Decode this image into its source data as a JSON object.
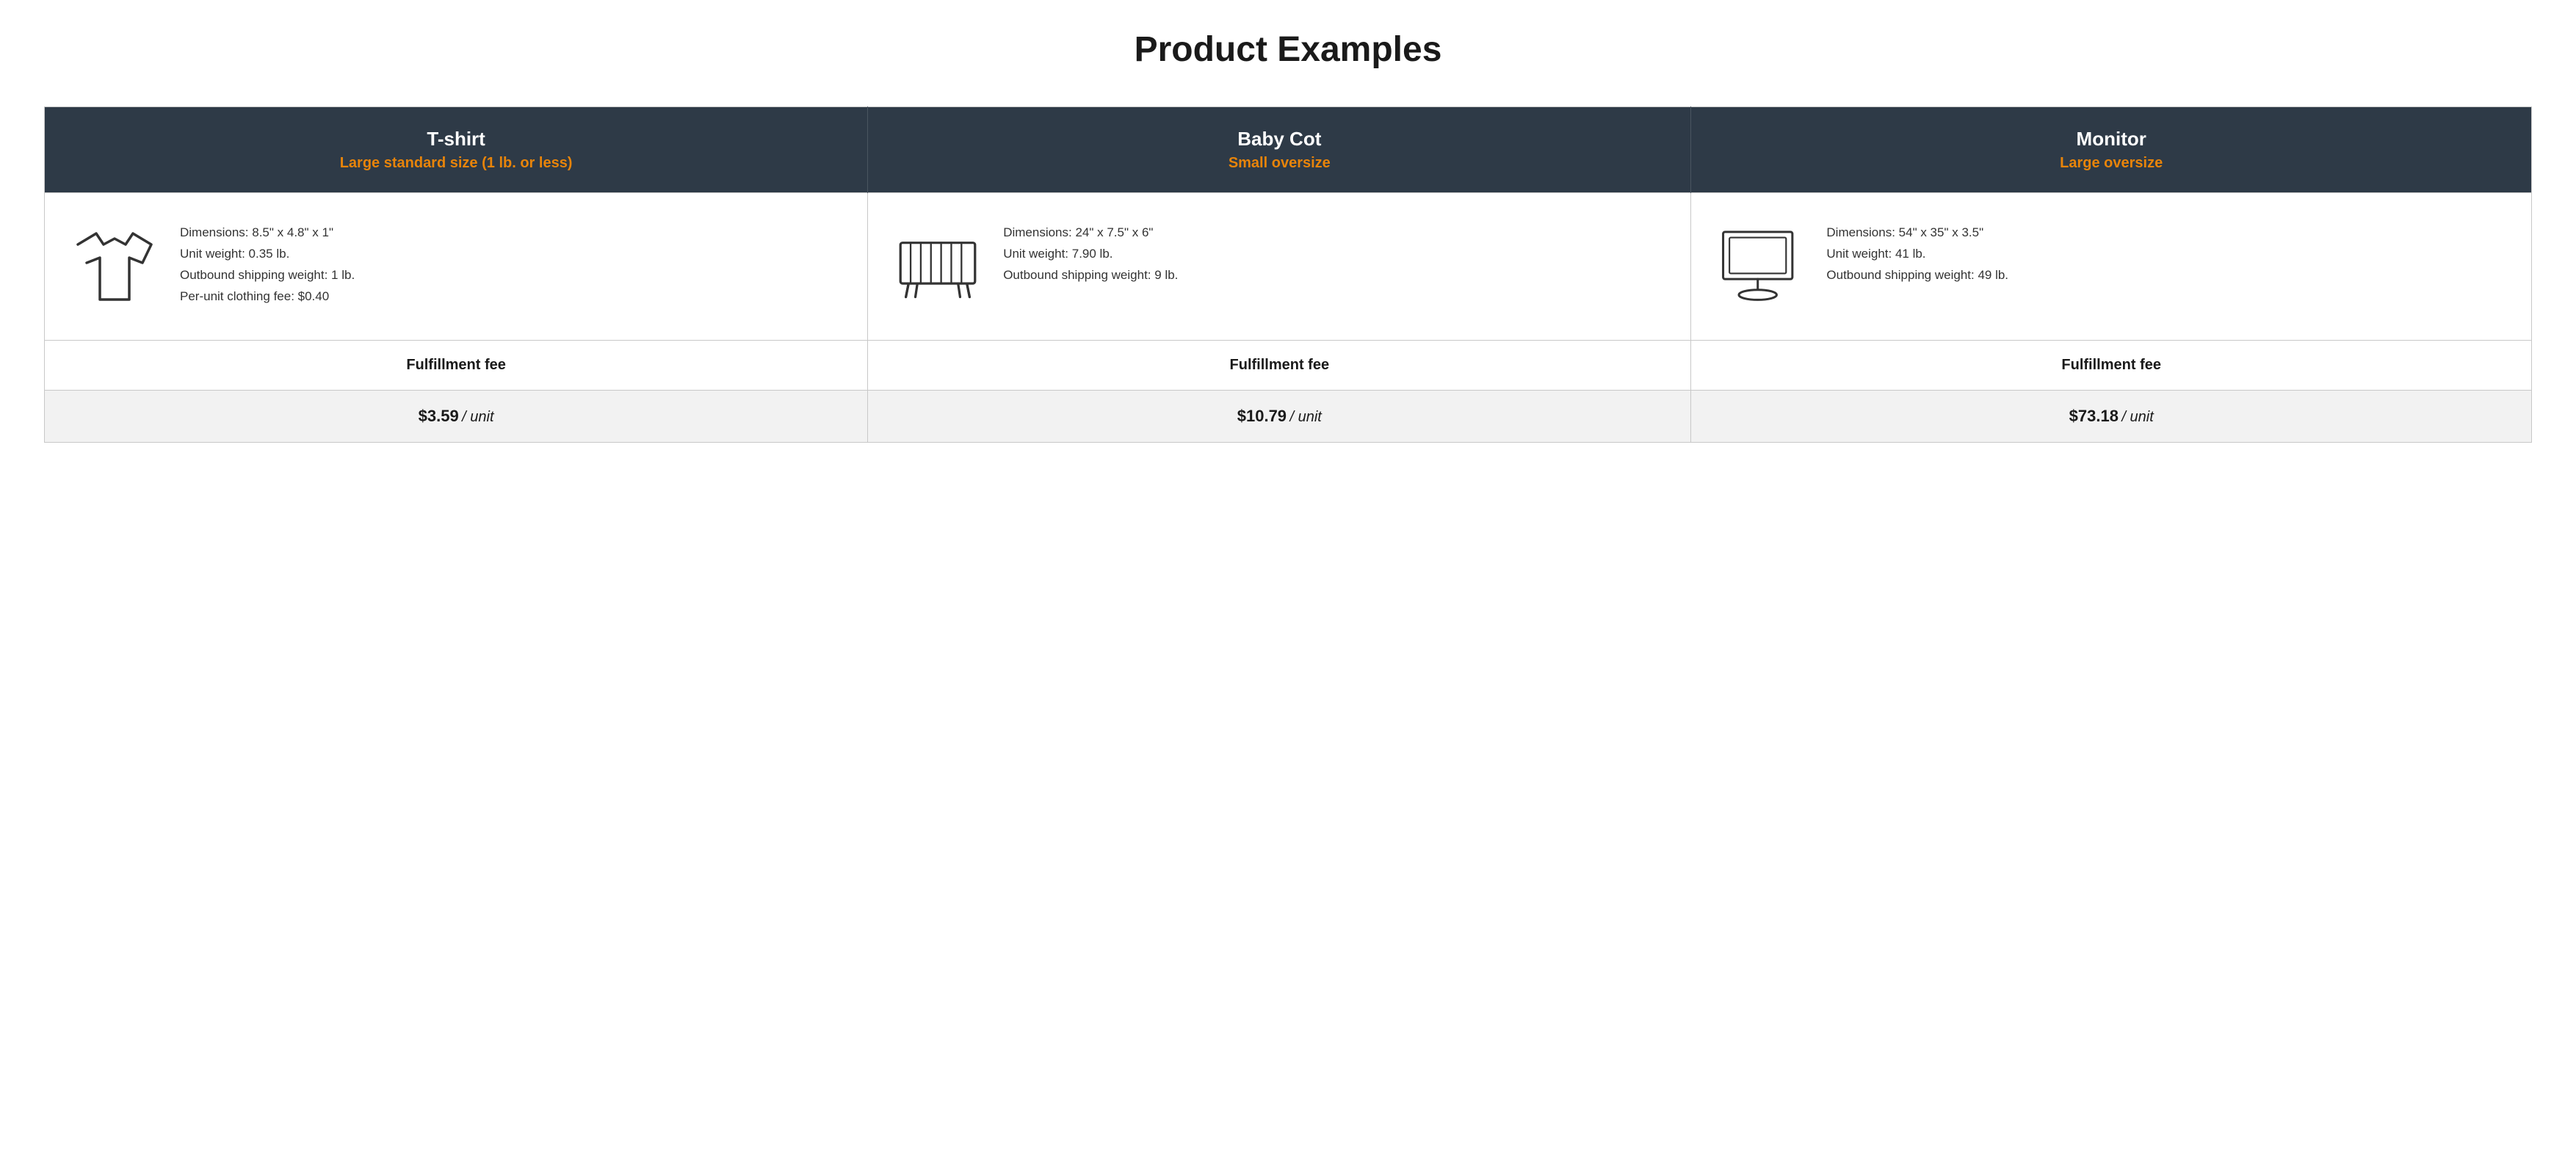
{
  "page": {
    "title": "Product Examples"
  },
  "products": [
    {
      "id": "tshirt",
      "name": "T-shirt",
      "size_label": "Large standard size (1 lb. or less)",
      "dimensions": "Dimensions: 8.5\" x 4.8\" x 1\"",
      "unit_weight": "Unit weight: 0.35 lb.",
      "outbound_shipping": "Outbound shipping weight: 1 lb.",
      "extra_fee": "Per-unit clothing fee: $0.40",
      "fulfillment_label": "Fulfillment fee",
      "fulfillment_price": "$3.59",
      "fulfillment_unit": "/ unit",
      "icon": "tshirt"
    },
    {
      "id": "babycot",
      "name": "Baby Cot",
      "size_label": "Small oversize",
      "dimensions": "Dimensions: 24\" x 7.5\" x 6\"",
      "unit_weight": "Unit weight: 7.90 lb.",
      "outbound_shipping": "Outbound shipping weight: 9 lb.",
      "extra_fee": "",
      "fulfillment_label": "Fulfillment fee",
      "fulfillment_price": "$10.79",
      "fulfillment_unit": "/ unit",
      "icon": "cot"
    },
    {
      "id": "monitor",
      "name": "Monitor",
      "size_label": "Large oversize",
      "dimensions": "Dimensions: 54\" x 35\" x 3.5\"",
      "unit_weight": "Unit weight: 41 lb.",
      "outbound_shipping": "Outbound shipping weight: 49 lb.",
      "extra_fee": "",
      "fulfillment_label": "Fulfillment fee",
      "fulfillment_price": "$73.18",
      "fulfillment_unit": "/ unit",
      "icon": "monitor"
    }
  ]
}
